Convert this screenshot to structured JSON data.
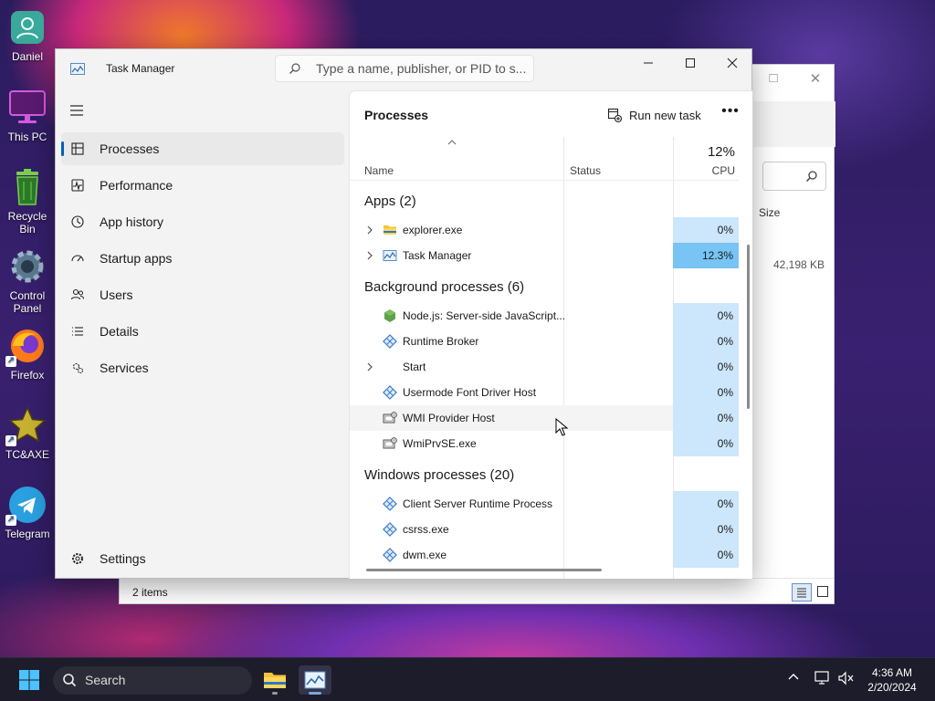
{
  "desktop": {
    "icons": [
      {
        "label": "Daniel",
        "icon": "user-folder-icon"
      },
      {
        "label": "This PC",
        "icon": "monitor-icon"
      },
      {
        "label": "Recycle Bin",
        "icon": "recycle-bin-icon"
      },
      {
        "label": "Control Panel",
        "icon": "gear-icon"
      },
      {
        "label": "Firefox",
        "icon": "firefox-icon"
      },
      {
        "label": "TC&AXE",
        "icon": "star-icon"
      },
      {
        "label": "Telegram",
        "icon": "telegram-icon"
      }
    ]
  },
  "explorer": {
    "size_header": "Size",
    "size_value": "42,198 KB",
    "status_text": "2 items"
  },
  "task_manager": {
    "title": "Task Manager",
    "search_placeholder": "Type a name, publisher, or PID to s...",
    "nav": [
      {
        "label": "Processes",
        "icon": "processes-icon",
        "active": true
      },
      {
        "label": "Performance",
        "icon": "performance-icon"
      },
      {
        "label": "App history",
        "icon": "app-history-icon"
      },
      {
        "label": "Startup apps",
        "icon": "startup-apps-icon"
      },
      {
        "label": "Users",
        "icon": "users-icon"
      },
      {
        "label": "Details",
        "icon": "details-icon"
      },
      {
        "label": "Services",
        "icon": "services-icon"
      }
    ],
    "settings_label": "Settings",
    "pane_title": "Processes",
    "run_new_task": "Run new task",
    "more_label": "•••",
    "columns": {
      "name": "Name",
      "status": "Status",
      "cpu_total": "12%",
      "cpu": "CPU"
    },
    "groups": [
      {
        "label": "Apps (2)",
        "rows": [
          {
            "name": "explorer.exe",
            "cpu": "0%",
            "icon": "folder-icon",
            "expandable": true
          },
          {
            "name": "Task Manager",
            "cpu": "12.3%",
            "icon": "task-manager-icon",
            "expandable": true,
            "hot": true
          }
        ]
      },
      {
        "label": "Background processes (6)",
        "rows": [
          {
            "name": "Node.js: Server-side JavaScript...",
            "cpu": "0%",
            "icon": "nodejs-icon"
          },
          {
            "name": "Runtime Broker",
            "cpu": "0%",
            "icon": "service-process-icon"
          },
          {
            "name": "Start",
            "cpu": "0%",
            "icon": "none",
            "expandable": true
          },
          {
            "name": "Usermode Font Driver Host",
            "cpu": "0%",
            "icon": "service-process-icon"
          },
          {
            "name": "WMI Provider Host",
            "cpu": "0%",
            "icon": "wmi-icon",
            "hover": true
          },
          {
            "name": "WmiPrvSE.exe",
            "cpu": "0%",
            "icon": "wmi-icon"
          }
        ]
      },
      {
        "label": "Windows processes (20)",
        "rows": [
          {
            "name": "Client Server Runtime Process",
            "cpu": "0%",
            "icon": "service-process-icon"
          },
          {
            "name": "csrss.exe",
            "cpu": "0%",
            "icon": "service-process-icon"
          },
          {
            "name": "dwm.exe",
            "cpu": "0%",
            "icon": "service-process-icon"
          }
        ]
      }
    ]
  },
  "taskbar": {
    "search_label": "Search",
    "time": "4:36 AM",
    "date": "2/20/2024"
  }
}
